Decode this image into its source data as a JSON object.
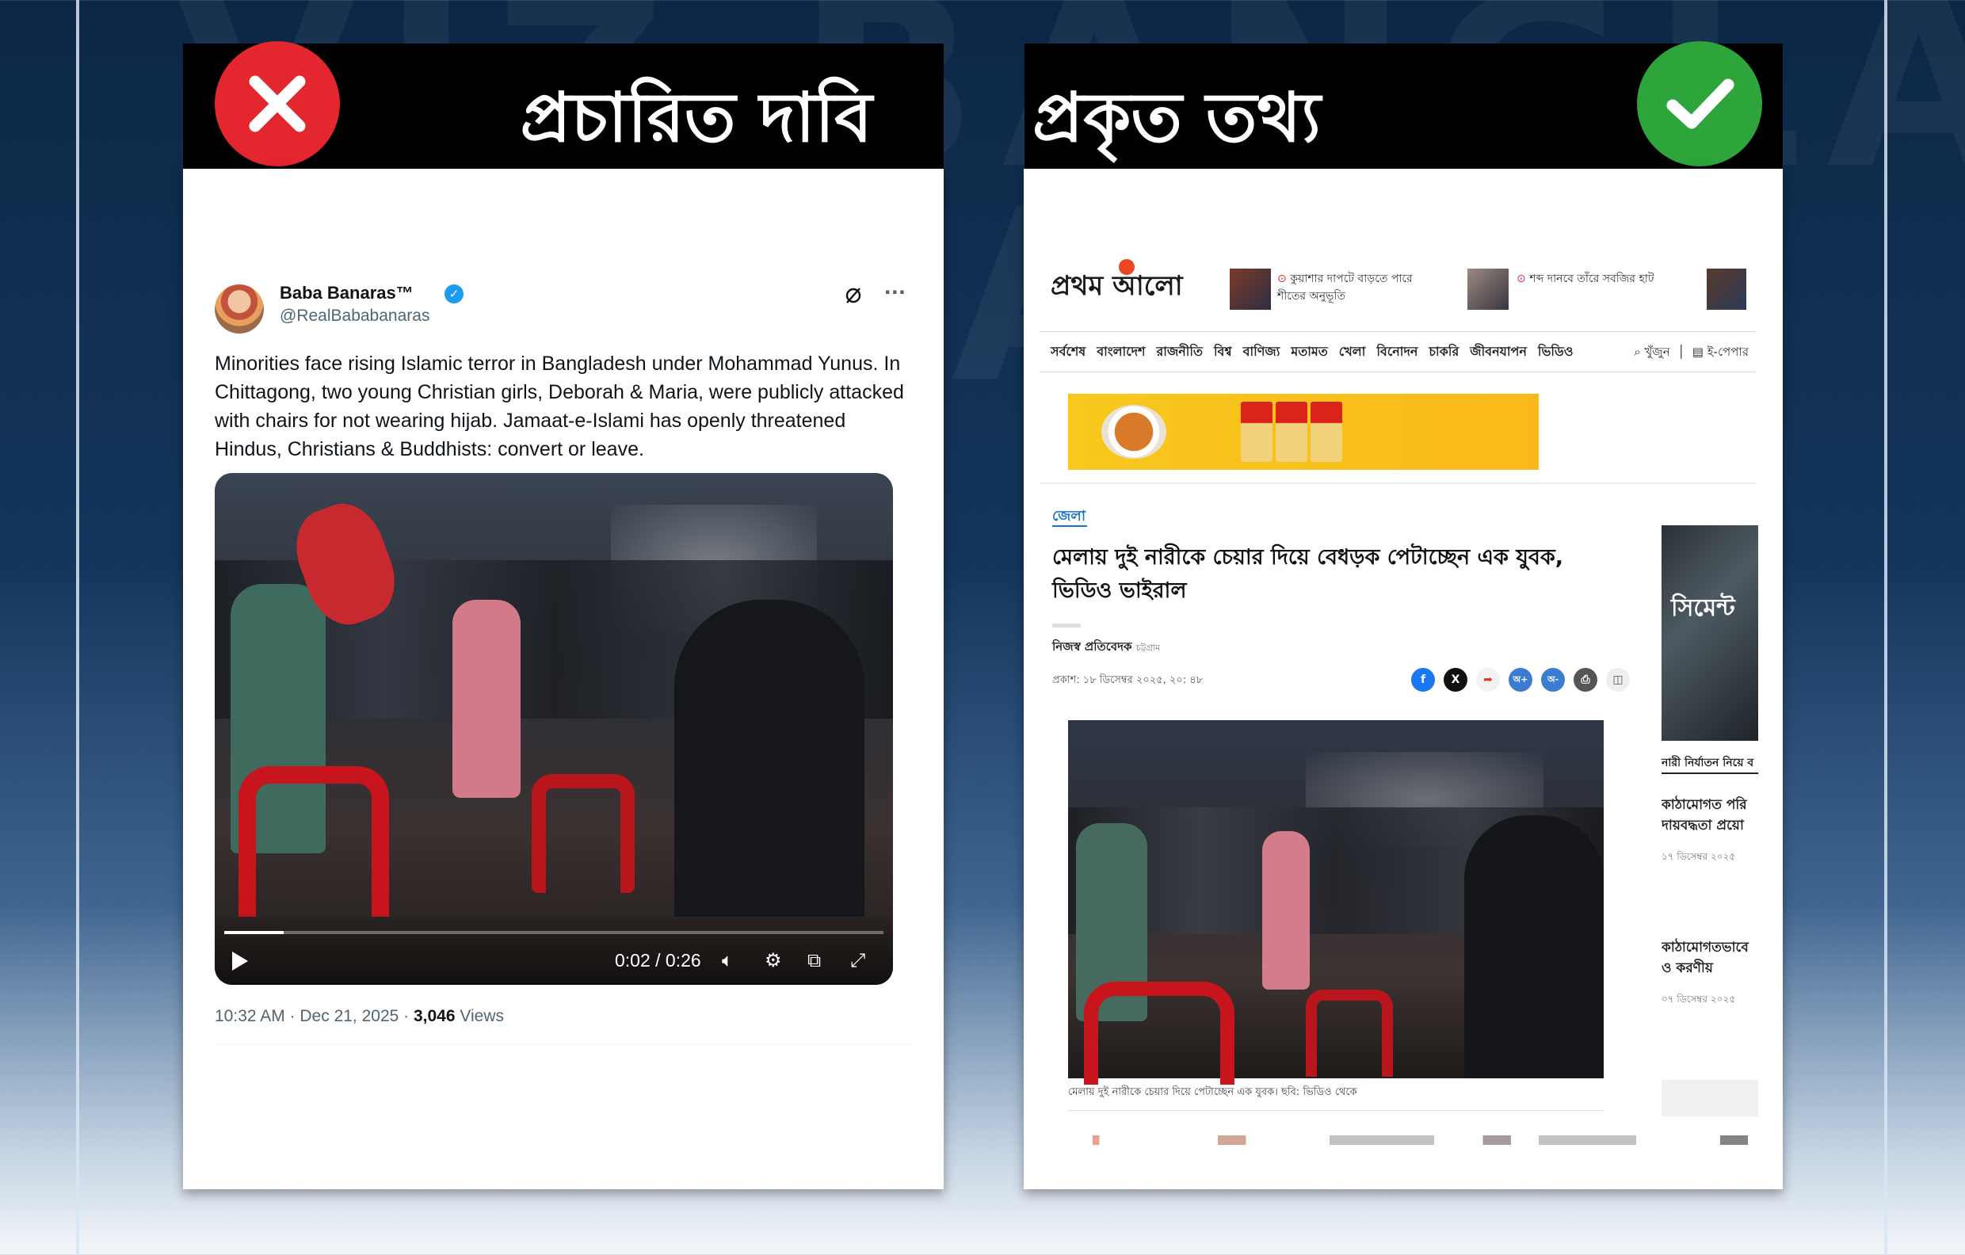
{
  "header": {
    "claim_label": "প্রচারিত দাবি",
    "fact_label": "প্রকৃত তথ্য"
  },
  "icons": {
    "wrong": "cross-icon",
    "right": "check-icon"
  },
  "colors": {
    "wrong_red": "#e4262f",
    "right_green": "#2ea53b"
  },
  "tweet": {
    "name": "Baba Banaras™",
    "handle": "@RealBababanaras",
    "text": "Minorities face rising Islamic terror in Bangladesh under Mohammad Yunus. In Chittagong, two young Christian girls, Deborah & Maria, were publicly attacked with chairs for not wearing hijab. Jamaat-e-Islami has openly threatened Hindus, Christians & Buddhists: convert or leave.",
    "video_time": "0:02 / 0:26",
    "video_progress": 0.09,
    "timestamp": "10:32 AM · Dec 21, 2025 · ",
    "views_count": "3,046",
    "views_label": " Views"
  },
  "newspaper": {
    "logo": "প্রথম আলো",
    "top_stories": [
      "কুয়াশার দাপটে বাড়তে পারে শীতের অনুভূতি",
      "শব্দ দানবে তাঁরে সবজির হাট"
    ],
    "nav": [
      "সর্বশেষ",
      "বাংলাদেশ",
      "রাজনীতি",
      "বিশ্ব",
      "বাণিজ্য",
      "মতামত",
      "খেলা",
      "বিনোদন",
      "চাকরি",
      "জীবনযাপন",
      "ভিডিও"
    ],
    "nav_search": "খুঁজুন",
    "nav_epaper": "ই-পেপার",
    "category": "জেলা",
    "headline": "মেলায় দুই নারীকে চেয়ার দিয়ে বেধড়ক পেটাচ্ছেন এক যুবক, ভিডিও ভাইরাল",
    "byline": "নিজস্ব প্রতিবেদক",
    "byline_place": "চট্টগ্রাম",
    "published": "প্রকাশ: ১৮ ডিসেম্বর ২০২৫, ২০: ৪৮",
    "caption": "মেলায় দুই নারীকে চেয়ার দিয়ে পেটাচ্ছেন এক যুবক। ছবি: ভিডিও থেকে",
    "side_image_text": "সিমেন্ট",
    "side_label": "নারী নির্যাতন নিয়ে ব",
    "side_stories": [
      {
        "title_1": "কাঠামোগত পরি",
        "title_2": "দায়বদ্ধতা প্রয়ো",
        "date": "১৭ ডিসেম্বর ২০২৫"
      },
      {
        "title_1": "কাঠামোগতভাবে",
        "title_2": "ও করণীয়",
        "date": "০৭ ডিসেম্বর ২০২৫"
      }
    ],
    "share_labels": [
      "f",
      "X",
      "➦",
      "অ+",
      "অ-",
      "⎙",
      "◫"
    ]
  }
}
